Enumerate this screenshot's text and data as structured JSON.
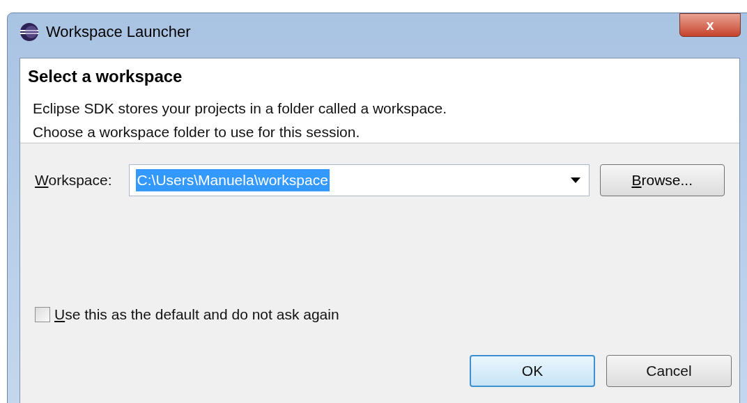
{
  "window": {
    "title": "Workspace Launcher",
    "close": "x"
  },
  "header": {
    "title": "Select a workspace",
    "lines": [
      "Eclipse SDK stores your projects in a folder called a workspace.",
      "Choose a workspace folder to use for this session."
    ]
  },
  "workspace": {
    "label": "Workspace:",
    "value": "C:\\Users\\Manuela\\workspace",
    "selected": true,
    "browse": "Browse..."
  },
  "default_checkbox": {
    "label": "Use this as the default and do not ask again",
    "checked": false
  },
  "buttons": [
    {
      "label": "OK",
      "default": true
    },
    {
      "label": "Cancel",
      "default": false
    }
  ]
}
